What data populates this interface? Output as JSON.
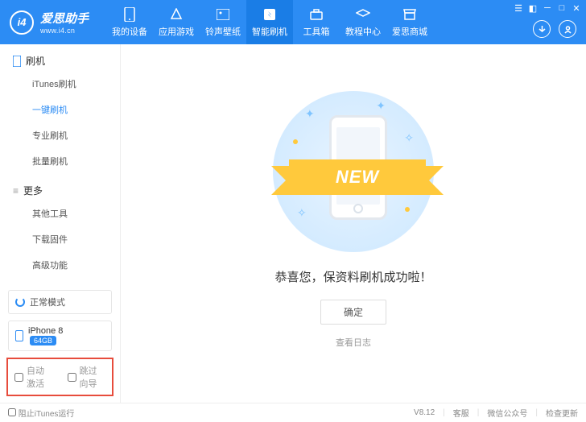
{
  "logo": {
    "mark": "i4",
    "title": "爱思助手",
    "url": "www.i4.cn"
  },
  "nav": [
    {
      "label": "我的设备"
    },
    {
      "label": "应用游戏"
    },
    {
      "label": "铃声壁纸"
    },
    {
      "label": "智能刷机"
    },
    {
      "label": "工具箱"
    },
    {
      "label": "教程中心"
    },
    {
      "label": "爱思商城"
    }
  ],
  "sidebar": {
    "section1": {
      "title": "刷机",
      "items": [
        "iTunes刷机",
        "一键刷机",
        "专业刷机",
        "批量刷机"
      ]
    },
    "section2": {
      "title": "更多",
      "items": [
        "其他工具",
        "下载固件",
        "高级功能"
      ]
    },
    "mode": "正常模式",
    "device": {
      "name": "iPhone 8",
      "storage": "64GB"
    },
    "checks": {
      "auto": "自动激活",
      "skip": "跳过向导"
    }
  },
  "content": {
    "ribbon": "NEW",
    "success": "恭喜您，保资料刷机成功啦！",
    "ok": "确定",
    "log": "查看日志"
  },
  "statusbar": {
    "block": "阻止iTunes运行",
    "version": "V8.12",
    "items": [
      "客服",
      "微信公众号",
      "检查更新"
    ]
  }
}
